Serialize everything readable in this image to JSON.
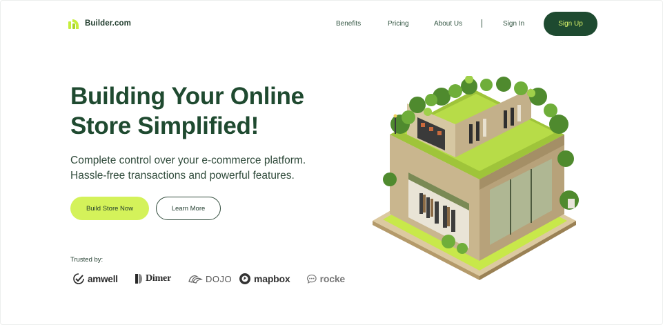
{
  "colors": {
    "brand_dark": "#1e4a30",
    "accent_lime": "#d4f25a",
    "text_dark": "#1f3b2c",
    "background": "#ffffff"
  },
  "header": {
    "logo_icon": "builder-logo-icon",
    "logo_text": "Builder.com",
    "nav": {
      "benefits": "Benefits",
      "pricing": "Pricing",
      "about": "About Us",
      "sign_in": "Sign In"
    },
    "sign_up": "Sign Up"
  },
  "hero": {
    "title_line1": "Building Your Online",
    "title_line2": "Store Simplified!",
    "subtitle_line1": "Complete control over your e-commerce platform.",
    "subtitle_line2": "Hassle-free transactions and powerful features.",
    "primary_cta": "Build Store Now",
    "secondary_cta": "Learn More",
    "illustration": "isometric-green-store-illustration"
  },
  "trusted": {
    "label": "Trusted by:",
    "brands": [
      "amwell",
      "Dimer",
      "DOJO",
      "mapbox",
      "rocke"
    ]
  }
}
